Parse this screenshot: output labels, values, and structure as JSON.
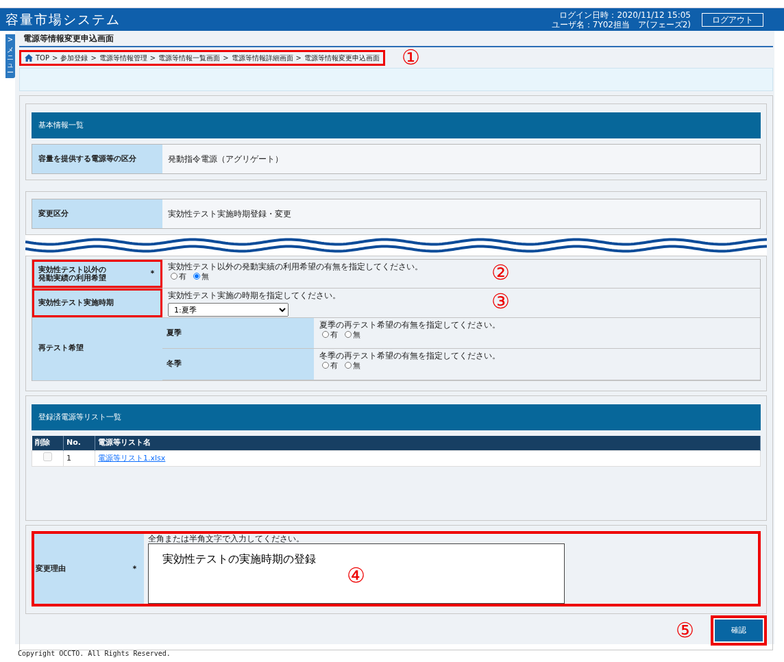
{
  "header": {
    "title": "容量市場システム",
    "login_time": "ログイン日時：2020/11/12 15:05",
    "user": "ユーザ名：7Y02担当　ア(フェーズ2)",
    "logout_button": "ログアウト"
  },
  "side_menu": {
    "arrow": ">",
    "label": "メニュー"
  },
  "page_title": "電源等情報変更申込画面",
  "breadcrumb": {
    "highlighted": true,
    "callout": "①",
    "separator": ">",
    "items": [
      "TOP",
      "参加登録",
      "電源等情報管理",
      "電源等情報一覧画面",
      "電源等情報詳細画面",
      "電源等情報変更申込画面"
    ]
  },
  "basic_info": {
    "title": "基本情報一覧",
    "rows": [
      {
        "label": "容量を提供する電源等の区分",
        "value": "発動指令電源（アグリゲート）"
      }
    ]
  },
  "change_type": {
    "label": "変更区分",
    "value": "実効性テスト実施時期登録・変更"
  },
  "settings": {
    "rows": [
      {
        "kind": "radio",
        "label_lines": [
          "実効性テスト以外の",
          "発動実績の利用希望"
        ],
        "required": "＊",
        "highlighted": true,
        "callout": "②",
        "hint": "実効性テスト以外の発動実績の利用希望の有無を指定してください。",
        "options": [
          {
            "label": "有",
            "selected": false
          },
          {
            "label": "無",
            "selected": true
          }
        ]
      },
      {
        "kind": "select",
        "label_lines": [
          "実効性テスト実施時期"
        ],
        "highlighted": true,
        "callout": "③",
        "hint": "実効性テスト実施の時期を指定してください。",
        "value": "1:夏季"
      },
      {
        "kind": "group",
        "label_lines": [
          "再テスト希望"
        ],
        "highlighted": false,
        "subrows": [
          {
            "label": "夏季",
            "hint": "夏季の再テスト希望の有無を指定してください。",
            "options": [
              {
                "label": "有",
                "selected": false
              },
              {
                "label": "無",
                "selected": false
              }
            ]
          },
          {
            "label": "冬季",
            "hint": "冬季の再テスト希望の有無を指定してください。",
            "options": [
              {
                "label": "有",
                "selected": false
              },
              {
                "label": "無",
                "selected": false
              }
            ]
          }
        ]
      }
    ]
  },
  "file_list": {
    "title": "登録済電源等リスト一覧",
    "columns": [
      "削除",
      "No.",
      "電源等リスト名"
    ],
    "rows": [
      {
        "checked": false,
        "disabled": true,
        "no": "1",
        "name": "電源等リスト1.xlsx"
      }
    ]
  },
  "reason": {
    "label": "変更理由",
    "required": "＊",
    "hint": "全角または半角文字で入力してください。",
    "value": "実効性テストの実施時期の登録",
    "highlighted": true,
    "callout": "④"
  },
  "confirm_button": {
    "label": "確認",
    "highlighted": true,
    "callout": "⑤"
  },
  "footer": "Copyright OCCTO. All Rights Reserved."
}
